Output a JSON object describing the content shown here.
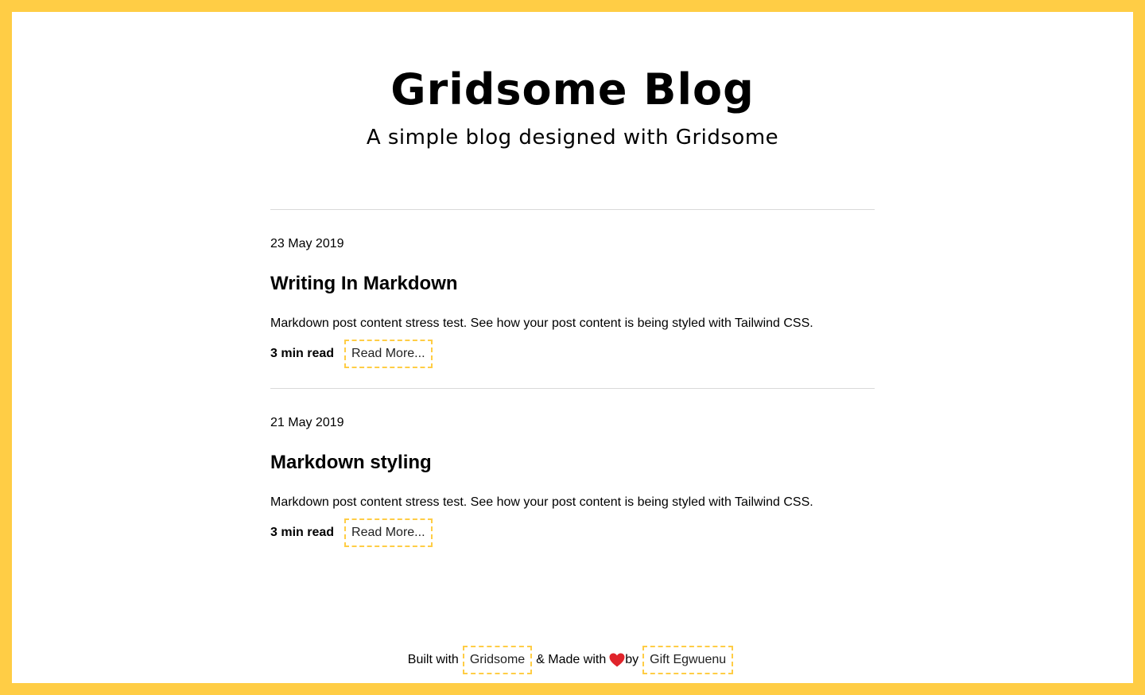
{
  "header": {
    "title": "Gridsome Blog",
    "subtitle": "A simple blog designed with Gridsome"
  },
  "posts": [
    {
      "date": "23 May 2019",
      "title": "Writing In Markdown",
      "excerpt": "Markdown post content stress test. See how your post content is being styled with Tailwind CSS.",
      "read_time": "3 min read",
      "read_more": "Read More..."
    },
    {
      "date": "21 May 2019",
      "title": "Markdown styling",
      "excerpt": "Markdown post content stress test. See how your post content is being styled with Tailwind CSS.",
      "read_time": "3 min read",
      "read_more": "Read More..."
    }
  ],
  "footer": {
    "built_with": "Built with",
    "gridsome_link": "Gridsome",
    "made_with": "& Made with",
    "heart_icon": "heart-icon",
    "by": "by",
    "author_link": "Gift Egwuenu"
  },
  "colors": {
    "accent": "#ffcd45",
    "heart": "#e0242b"
  }
}
